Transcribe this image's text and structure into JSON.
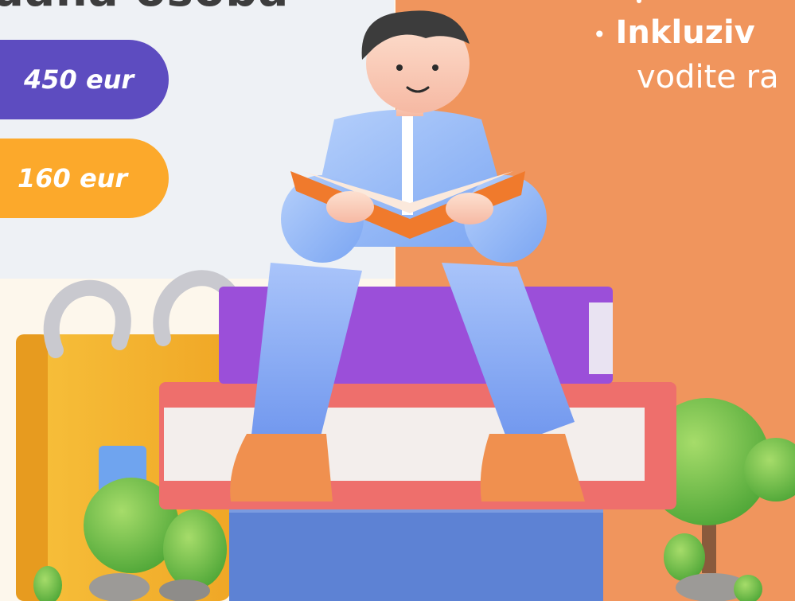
{
  "header": {
    "partial_title": "dana osoba"
  },
  "prices": [
    {
      "label": "450 eur",
      "color": "#5d4cc0"
    },
    {
      "label": "160 eur",
      "color": "#fca92b"
    }
  ],
  "list": {
    "bullet": "•",
    "item_bold": "Inkluziv",
    "item_continuation": "vodite ra"
  },
  "colors": {
    "right_panel": "#f0955d",
    "left_panel": "#eef1f5",
    "page_background": "#fdf7ec"
  },
  "illustration": {
    "subject": "3d-boy-reading-book-on-stack-of-books",
    "icons": [
      "calendar-icon",
      "book-icon",
      "tree-icon",
      "bush-icon",
      "rock-icon"
    ]
  }
}
